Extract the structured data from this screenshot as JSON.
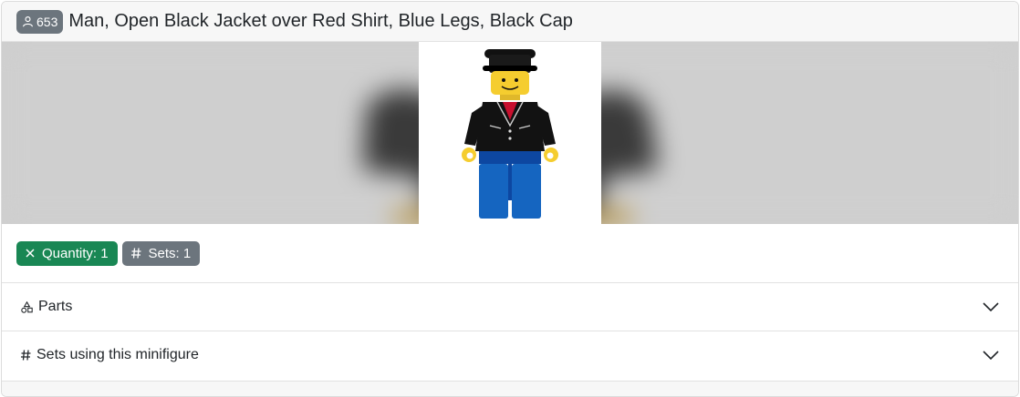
{
  "header": {
    "id_badge": "653",
    "title": "Man, Open Black Jacket over Red Shirt, Blue Legs, Black Cap",
    "badge_icon": "person-icon"
  },
  "badges": {
    "quantity": "Quantity: 1",
    "quantity_icon": "times-icon",
    "sets": "Sets: 1",
    "sets_icon": "hash-icon"
  },
  "accordion": [
    {
      "label": "Parts",
      "icon": "shapes-icon"
    },
    {
      "label": "Sets using this minifigure",
      "icon": "hash-icon"
    }
  ],
  "colors": {
    "badge_gray": "#6c757d",
    "badge_green": "#198754"
  }
}
